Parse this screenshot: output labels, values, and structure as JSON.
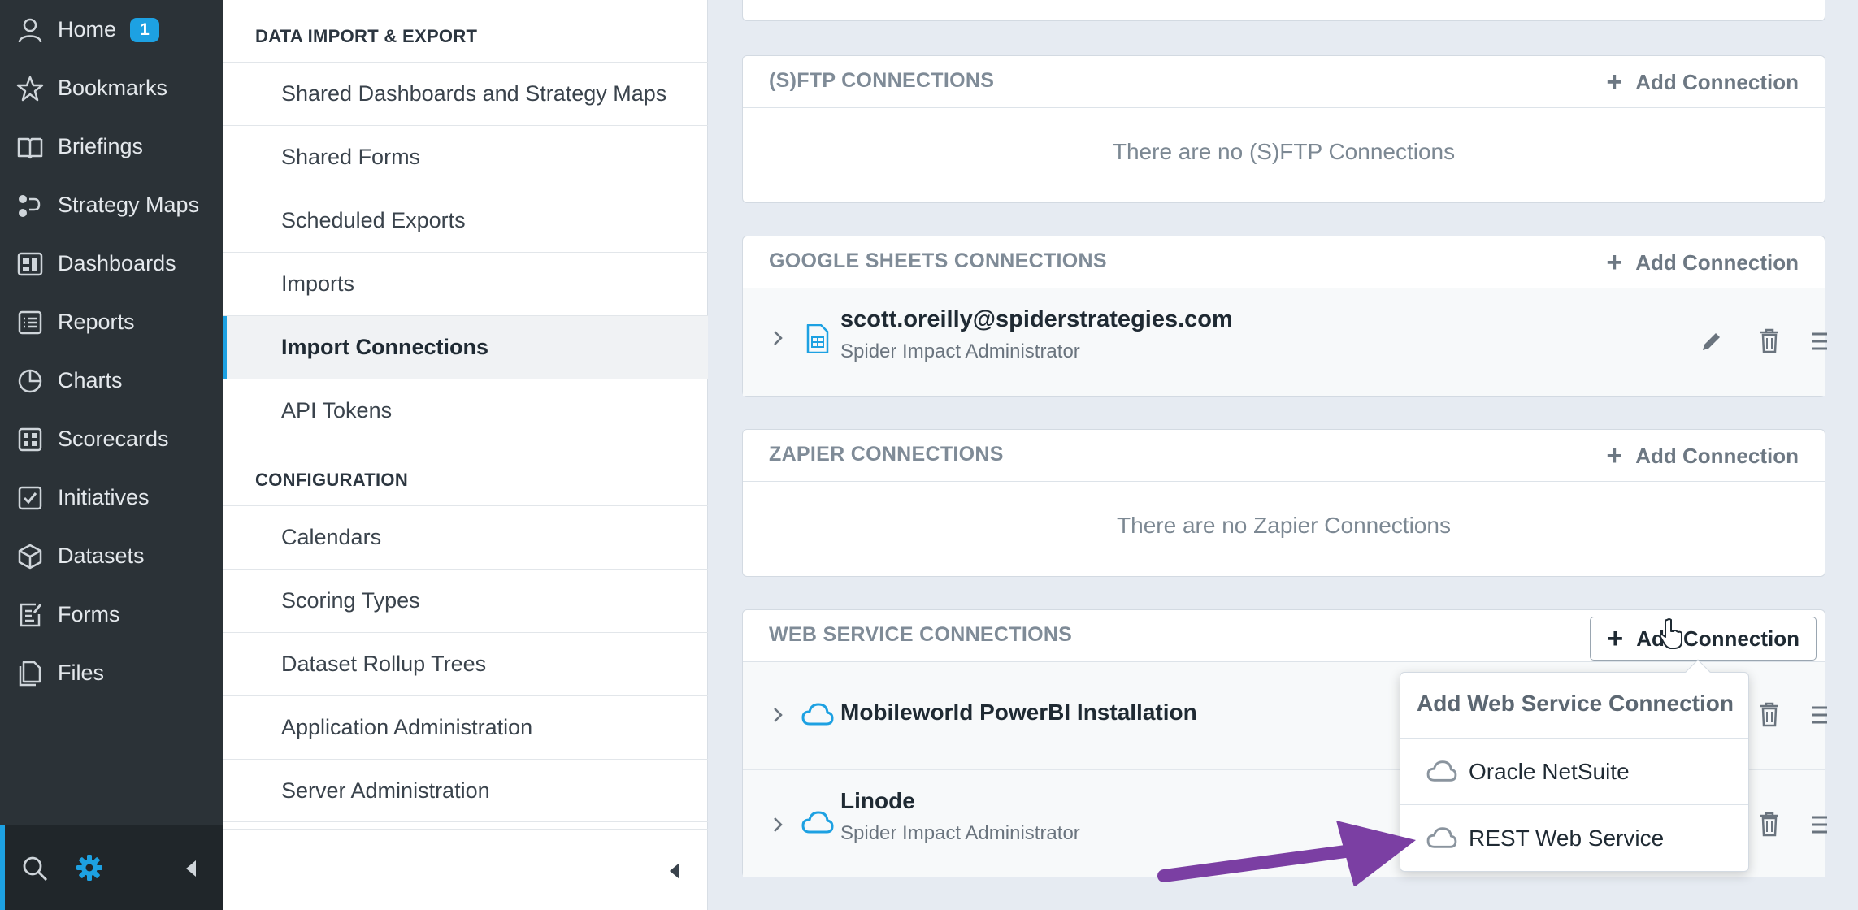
{
  "nav": {
    "items": [
      {
        "label": "Home",
        "badge": "1"
      },
      {
        "label": "Bookmarks"
      },
      {
        "label": "Briefings"
      },
      {
        "label": "Strategy Maps"
      },
      {
        "label": "Dashboards"
      },
      {
        "label": "Reports"
      },
      {
        "label": "Charts"
      },
      {
        "label": "Scorecards"
      },
      {
        "label": "Initiatives"
      },
      {
        "label": "Datasets"
      },
      {
        "label": "Forms"
      },
      {
        "label": "Files"
      }
    ]
  },
  "menu": {
    "section_1": "DATA IMPORT & EXPORT",
    "items_1": [
      "Shared Dashboards and Strategy Maps",
      "Shared Forms",
      "Scheduled Exports",
      "Imports",
      "Import Connections",
      "API Tokens"
    ],
    "active": "Import Connections",
    "section_2": "CONFIGURATION",
    "items_2": [
      "Calendars",
      "Scoring Types",
      "Dataset Rollup Trees",
      "Application Administration",
      "Server Administration"
    ]
  },
  "panels": {
    "add_label": "Add Connection",
    "sftp": {
      "title": "(S)FTP CONNECTIONS",
      "empty": "There are no (S)FTP Connections"
    },
    "google": {
      "title": "GOOGLE SHEETS CONNECTIONS",
      "row": {
        "name": "scott.oreilly@spiderstrategies.com",
        "sub": "Spider Impact Administrator"
      }
    },
    "zapier": {
      "title": "ZAPIER CONNECTIONS",
      "empty": "There are no Zapier Connections"
    },
    "web": {
      "title": "WEB SERVICE CONNECTIONS",
      "rows": [
        {
          "name": "Mobileworld PowerBI Installation",
          "sub": ""
        },
        {
          "name": "Linode",
          "sub": "Spider Impact Administrator"
        }
      ]
    }
  },
  "dropdown": {
    "title": "Add Web Service Connection",
    "options": [
      "Oracle NetSuite",
      "REST Web Service"
    ]
  },
  "colors": {
    "accent": "#1da1e2",
    "nav_bg": "#2b3237",
    "arrow": "#7b3fa3"
  }
}
